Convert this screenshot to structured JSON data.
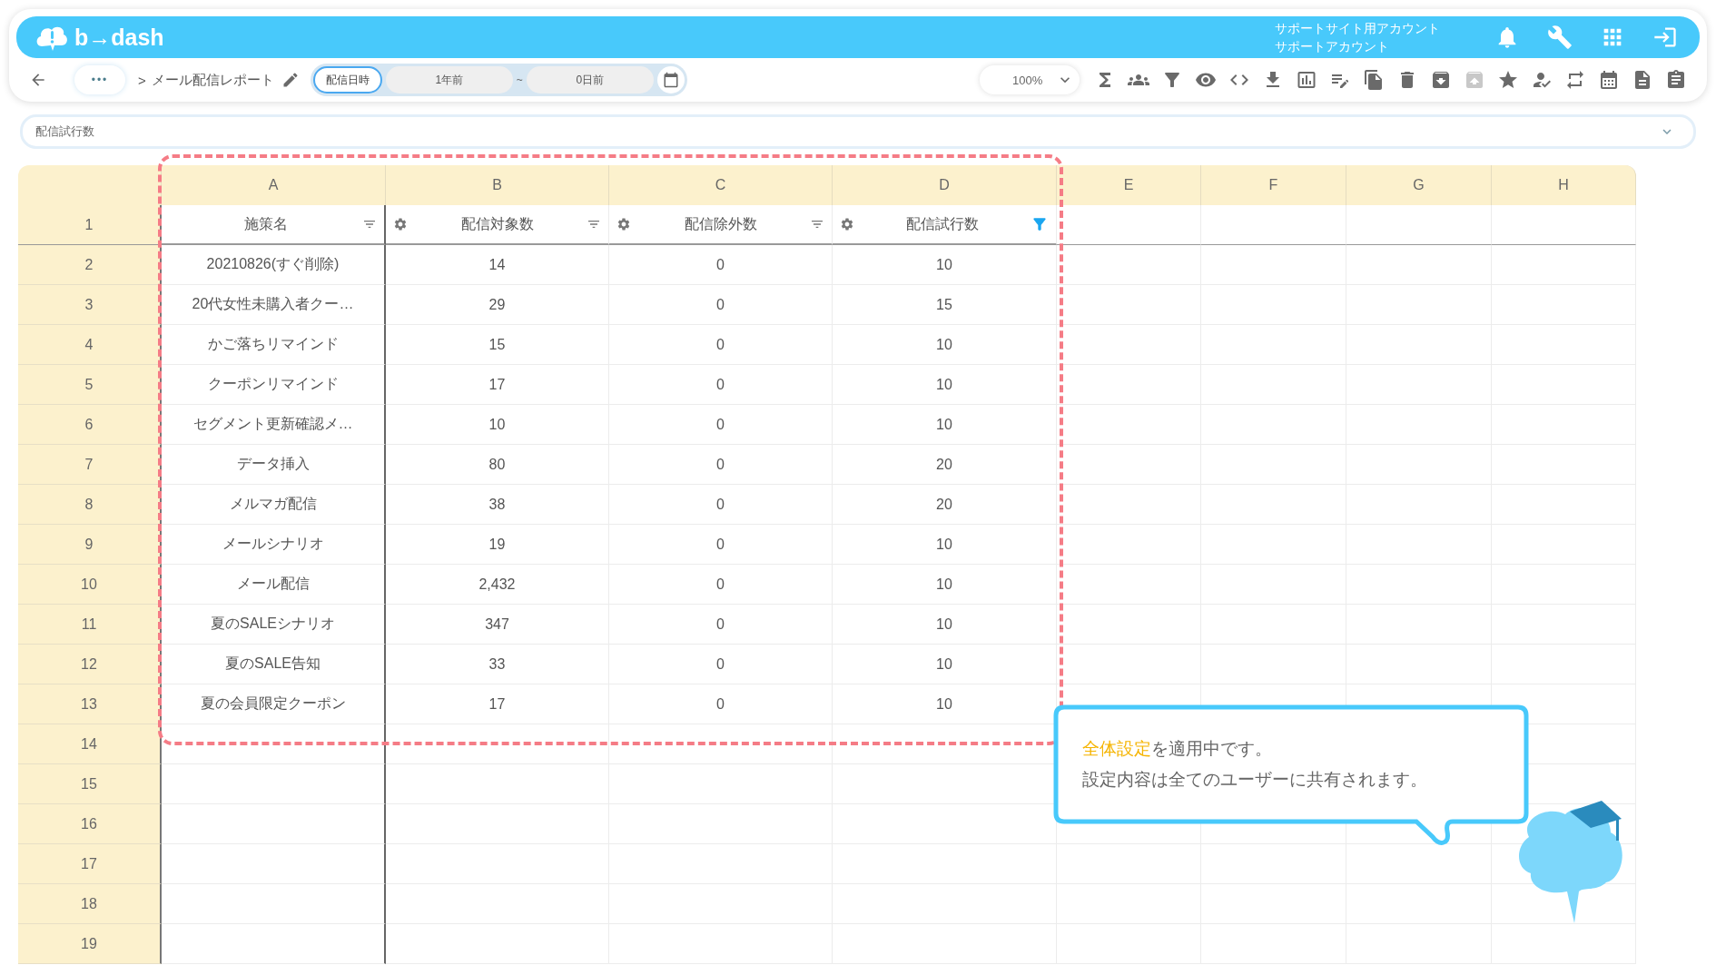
{
  "header": {
    "logo": "b→dash",
    "account_line1": "サポートサイト用アカウント",
    "account_line2": "サポートアカウント"
  },
  "toolbar": {
    "breadcrumb_more": "•••",
    "breadcrumb_separator": ">",
    "report_title": "メール配信レポート",
    "date_field": {
      "label": "配信日時",
      "from": "1年前",
      "separator": "~",
      "to": "0日前"
    },
    "zoom": "100%",
    "actions": [
      {
        "disabled": false
      },
      {
        "disabled": false
      },
      {
        "disabled": false
      },
      {
        "disabled": false
      },
      {
        "disabled": false
      },
      {
        "disabled": false
      },
      {
        "disabled": false
      },
      {
        "disabled": false
      },
      {
        "disabled": false
      },
      {
        "disabled": false
      },
      {
        "disabled": false
      },
      {
        "disabled": true
      },
      {
        "disabled": false
      },
      {
        "disabled": false
      },
      {
        "disabled": false
      },
      {
        "disabled": false
      },
      {
        "disabled": false
      },
      {
        "disabled": false
      }
    ]
  },
  "metric_select": {
    "value": "配信試行数"
  },
  "sheet": {
    "columns": [
      "A",
      "B",
      "C",
      "D",
      "E",
      "F",
      "G",
      "H"
    ],
    "header_row": {
      "number": "1",
      "cells": [
        {
          "label": "施策名",
          "settings": false,
          "filtered": false
        },
        {
          "label": "配信対象数",
          "settings": true,
          "filtered": false
        },
        {
          "label": "配信除外数",
          "settings": true,
          "filtered": false
        },
        {
          "label": "配信試行数",
          "settings": true,
          "filtered": true
        }
      ]
    },
    "rows": [
      {
        "number": "2",
        "cells": [
          "20210826(すぐ削除)",
          "14",
          "0",
          "10"
        ]
      },
      {
        "number": "3",
        "cells": [
          "20代女性未購入者クー…",
          "29",
          "0",
          "15"
        ]
      },
      {
        "number": "4",
        "cells": [
          "かご落ちリマインド",
          "15",
          "0",
          "10"
        ]
      },
      {
        "number": "5",
        "cells": [
          "クーポンリマインド",
          "17",
          "0",
          "10"
        ]
      },
      {
        "number": "6",
        "cells": [
          "セグメント更新確認メ…",
          "10",
          "0",
          "10"
        ]
      },
      {
        "number": "7",
        "cells": [
          "データ挿入",
          "80",
          "0",
          "20"
        ]
      },
      {
        "number": "8",
        "cells": [
          "メルマガ配信",
          "38",
          "0",
          "20"
        ]
      },
      {
        "number": "9",
        "cells": [
          "メールシナリオ",
          "19",
          "0",
          "10"
        ]
      },
      {
        "number": "10",
        "cells": [
          "メール配信",
          "2,432",
          "0",
          "10"
        ]
      },
      {
        "number": "11",
        "cells": [
          "夏のSALEシナリオ",
          "347",
          "0",
          "10"
        ]
      },
      {
        "number": "12",
        "cells": [
          "夏のSALE告知",
          "33",
          "0",
          "10"
        ]
      },
      {
        "number": "13",
        "cells": [
          "夏の会員限定クーポン",
          "17",
          "0",
          "10"
        ]
      },
      {
        "number": "14",
        "cells": []
      },
      {
        "number": "15",
        "cells": []
      },
      {
        "number": "16",
        "cells": []
      },
      {
        "number": "17",
        "cells": []
      },
      {
        "number": "18",
        "cells": []
      },
      {
        "number": "19",
        "cells": []
      }
    ]
  },
  "callout": {
    "highlight": "全体設定",
    "line1_rest": "を適用中です。",
    "line2": "設定内容は全てのユーザーに共有されます。"
  }
}
